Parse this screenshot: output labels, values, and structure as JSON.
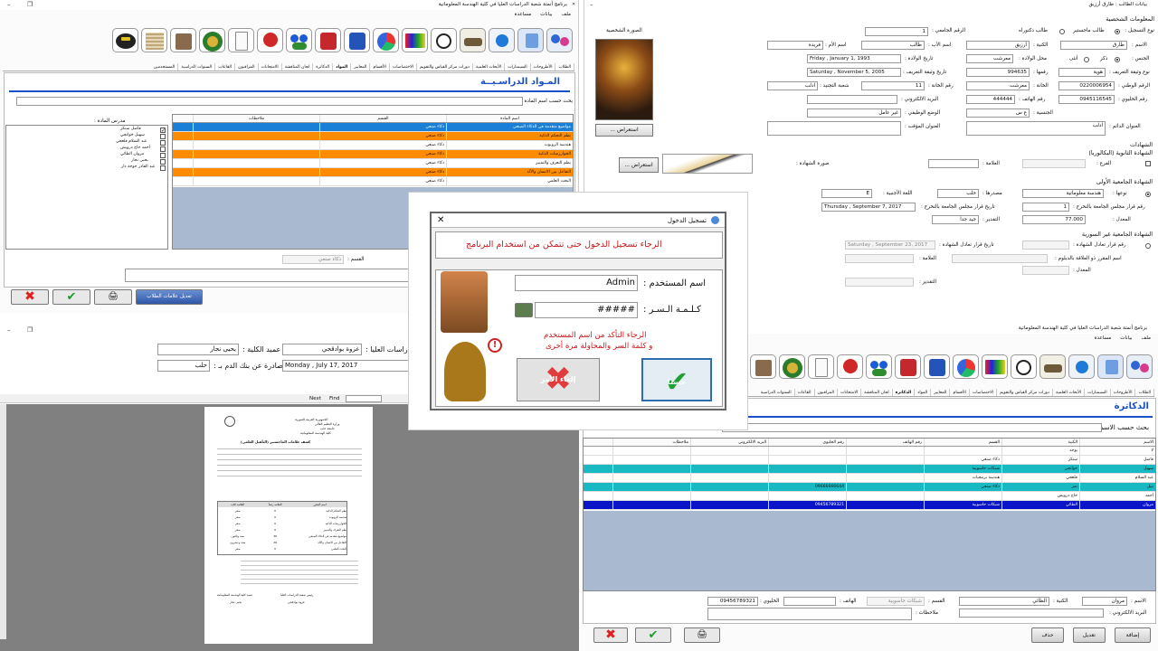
{
  "win_subjects": {
    "title": "برنامج أتمتة شعبة الدراسات العليا في كلية الهندسة المعلوماتية",
    "menu": [
      "ملف",
      "بيانات",
      "مساعدة"
    ],
    "tabs": [
      "الطلاب",
      "الأطروحات",
      "السيمنارات",
      "الأبحاث العلمية",
      "دورات مركز القياس والتقويم",
      "الاختصاصات",
      "الأقسام",
      "المعايير",
      "المواد",
      "الدكاترة",
      "لجان المناقشة",
      "الامتحانات",
      "المراقبون",
      "القاعات",
      "السنوات الدراسية",
      "المستخدمين"
    ],
    "active_tab": "المواد",
    "heading": "المـواد الدراسـيــة",
    "search_label": "بحث حسب اسم المادة :",
    "teachers_label": "مدرس المادة :",
    "teachers": [
      "فاضل سنكر",
      "سهيل خوانجي",
      "عبد السلام قلعجي",
      "أحمد حاج درويش",
      "مروان الطائي",
      "يحيى نجار",
      "عبد القادر جوجة دار"
    ],
    "teacher_checked": [
      true,
      false,
      false,
      false,
      false,
      false,
      false
    ],
    "columns": [
      "اسم المادة",
      "القسم",
      "ملاحظات"
    ],
    "rows": [
      {
        "name": "مواضيع متقدمة في الذكاء الصنعي",
        "dept": "ذكاء صنعي",
        "style": "blue"
      },
      {
        "name": "نظم التحكم الذكية",
        "dept": "ذكاء صنعي",
        "style": "orange"
      },
      {
        "name": "هندسة الروبوت",
        "dept": "ذكاء صنعي",
        "style": "white"
      },
      {
        "name": "الخوارزميات الذكية",
        "dept": "ذكاء صنعي",
        "style": "orange"
      },
      {
        "name": "نظم التعرف والتمييز",
        "dept": "ذكاء صنعي",
        "style": "white"
      },
      {
        "name": "التفاعل بين الانسان والآلة",
        "dept": "ذكاء صنعي",
        "style": "orange"
      },
      {
        "name": "البحث العلمي",
        "dept": "ذكاء صنعي",
        "style": "white"
      }
    ],
    "dept_label": "القسم :",
    "dept_value": "ذكاء صنعي",
    "edit_button": "تعديل علامات الطلاب"
  },
  "win_student": {
    "title": "بيانات الطالب : طارق أرزيق",
    "personal_section": "المعلومات الشخصية",
    "reg_type_label": "نوع التسجيل :",
    "reg_type_options": [
      "طالب ماجستير",
      "طالب دكتوراه"
    ],
    "uni_no_label": "الرقم الجامعي :",
    "uni_no": "1",
    "photo_label": "الصورة الشخصية",
    "photo_button": "استعراض ...",
    "name_label": "الاسم :",
    "name": "طارق",
    "surname_label": "الكنية :",
    "surname": "أرزيق",
    "father_label": "اسم الأب :",
    "father": "طالب",
    "mother_label": "اسم الأم :",
    "mother": "فريدة",
    "gender_label": "الجنس :",
    "gender_options": [
      "ذكر",
      "أنثى"
    ],
    "birthplace_label": "محل الولادة :",
    "birthplace": "معرشت",
    "birthdate_label": "تاريخ الولادة :",
    "birthdate": "Friday ,  January   1, 1993",
    "id_type_label": "نوع وثيقة التعريف :",
    "id_type": "هوية",
    "id_no_label": "رقمها :",
    "id_no": "994635",
    "id_date_label": "تاريخ وثيقة التعريف :",
    "id_date": "Saturday , November   5, 2005",
    "national_no_label": "الرقم الوطني :",
    "national_no": "0220006954",
    "issuer_label": "الخانة :",
    "issuer": "معرشت",
    "registry_no_label": "رقم الخانة :",
    "registry_no": "11",
    "recruit_label": "شعبة التجنيد :",
    "recruit": "ادلب",
    "mobile_label": "رقم الخليوي :",
    "mobile": "0945116545",
    "phone_label": "رقم الهاتف :",
    "phone": "444444",
    "email_label": "البريد الالكتروني :",
    "nationality_label": "الجنسية :",
    "nationality": "ع س",
    "job_label": "الوضع الوظيفي :",
    "job": "غير عامل",
    "address_label": "العنوان الدائم :",
    "address": "ادلب",
    "temp_address_label": "العنوان المؤقت :",
    "certs_section": "الشهادات",
    "secondary_section": "الشهادة الثانوية (البكالوريا)",
    "branch_label": "الفرع :",
    "mark_label": "العلامة :",
    "cert_image_label": "صورة الشهادة :",
    "cert_browse": "استعراض ...",
    "first_degree_section": "الشهادة الجامعية الأولى",
    "type_label": "نوعها :",
    "degree_type": "هندسة معلوماتية",
    "source_label": "مصدرها :",
    "source": "حلب",
    "lang_label": "اللغة الأجنبية :",
    "lang": "E",
    "decision_no_label": "رقم قرار مجلس الجامعة بالتخرج :",
    "decision_no": "1",
    "decision_date_label": "تاريخ قرار مجلس الجامعة بالتخرج :",
    "decision_date": "Thursday ,  September  7, 2017",
    "average_label": "المعدل :",
    "average": "77.000",
    "grade_label": "التقدير :",
    "grade": "جيد جدا",
    "nonsyrian_section": "الشهادة الجامعية غير السورية",
    "equiv_no_label": "رقم قرار تعادل الشهادة :",
    "equiv_date_label": "تاريخ قرار تعادل الشهادة :",
    "equiv_date": "Saturday , September 23, 2017",
    "decision_mark_label": "اسم المقرر ذو العلاقة بالدبلوم :",
    "mark2_label": "العلامة :",
    "average2_label": "المعدل :",
    "grade2_label": "التقدير :"
  },
  "win_report": {
    "dean_label": "عميد الكلية :",
    "dean": "يحيى نجار",
    "studies_label": "دراسات العليا :",
    "studies": "غزوة بوادقجي",
    "issued_label": "صادرة عن بنك الدم بـ :",
    "issued": "حلب",
    "date": "Monday ,    July   17, 2017",
    "toolbar": [
      "Next",
      "Find"
    ],
    "doc_header": [
      "الجمهورية العربية السورية",
      "وزارة التعليم العالي",
      "جامعة حلب",
      "كلية الهندسة المعلوماتية"
    ],
    "doc_title": "كشف علامات الماجستير (التأهيل العلمي)",
    "doc_table_header": [
      "اسم المقرر",
      "العلامة رقماً",
      "العلامة كتابة"
    ],
    "doc_rows": [
      {
        "name": "نظم التحكم الذكية",
        "num": "0",
        "text": "صفر"
      },
      {
        "name": "هندسة الروبوت",
        "num": "0",
        "text": "صفر"
      },
      {
        "name": "الخوارزميات الذكية",
        "num": "0",
        "text": "صفر"
      },
      {
        "name": "نظم التعرف والتمييز",
        "num": "0",
        "text": "صفر"
      },
      {
        "name": "مواضيع متقدمة في الذكاء الصنعي",
        "num": "36",
        "text": "ستة وثلاثون"
      },
      {
        "name": "التفاعل بين الانسان والآلة",
        "num": "26",
        "text": "ستة وعشرون"
      },
      {
        "name": "البحث العلمي",
        "num": "0",
        "text": "صفر"
      }
    ],
    "doc_footer": [
      "رئيس شعبة الدراسات العليا",
      "عميد كلية الهندسة المعلوماتية",
      "غزوة بوادقجي",
      "يحيى نجار"
    ]
  },
  "login": {
    "title": "تسجيل الدخول",
    "banner": "الرجاء تسجيل الدخول حتى تتمكن من استخدام البرنامج",
    "user_label": "اسم المستخدم :",
    "user": "Admin",
    "pass_label": "كـلـمـة الـسـر :",
    "pass": "#####",
    "hint1": "الرجاء التأكد من اسم المستخدم",
    "hint2": "و كلمة السر والمحاولة مرة أخرى",
    "ok": "حسنا",
    "cancel": "إلغاء الأمر"
  },
  "win_doctors": {
    "title": "برنامج أتمتة شعبة الدراسات العليا في كلية الهندسة المعلوماتية",
    "menu": [
      "ملف",
      "بيانات",
      "مساعدة"
    ],
    "active_tab": "الدكاترة",
    "heading": "الدكاترة",
    "search_label": "بحث حسب الاسم :",
    "columns": [
      "الاسم",
      "الكنية",
      "القسم",
      "رقم الهاتف",
      "رقم الخليوي",
      "البريد الالكتروني",
      "ملاحظات"
    ],
    "rows": [
      {
        "first": "لا",
        "last": "يوجد",
        "dept": "",
        "phone": "",
        "mobile": "",
        "style": "white"
      },
      {
        "first": "فاضل",
        "last": "سنكر",
        "dept": "ذكاء صنعي",
        "phone": "",
        "mobile": "",
        "style": "white"
      },
      {
        "first": "سهيل",
        "last": "خوانجي",
        "dept": "شبكات حاسوبية",
        "phone": "",
        "mobile": "",
        "style": "cyan"
      },
      {
        "first": "عبد السلام",
        "last": "قلعجي",
        "dept": "هندسة برمجيات",
        "phone": "",
        "mobile": "",
        "style": "white"
      },
      {
        "first": "نبيل",
        "last": "تمر",
        "dept": "ذكاء صنعي",
        "phone": "",
        "mobile": "09666666644",
        "style": "cyan"
      },
      {
        "first": "أحمد",
        "last": "حاج درويش",
        "dept": "",
        "phone": "",
        "mobile": "",
        "style": "white"
      },
      {
        "first": "مروان",
        "last": "الطائي",
        "dept": "شبكات حاسوبية",
        "phone": "",
        "mobile": "09456789321",
        "style": "navy"
      }
    ],
    "f_name_label": "الاسم :",
    "f_name": "مروان",
    "f_last_label": "الكنية :",
    "f_last": "الطائي",
    "f_dept_label": "القسم :",
    "f_dept": "شبكات حاسوبية",
    "f_phone_label": "الهاتف :",
    "f_mobile_label": "الخليوي :",
    "f_mobile": "09456789321",
    "f_email_label": "البريد الالكتروني :",
    "f_notes_label": "ملاحظات :",
    "btn_add": "إضافة",
    "btn_edit": "تعديل",
    "btn_delete": "حذف"
  }
}
